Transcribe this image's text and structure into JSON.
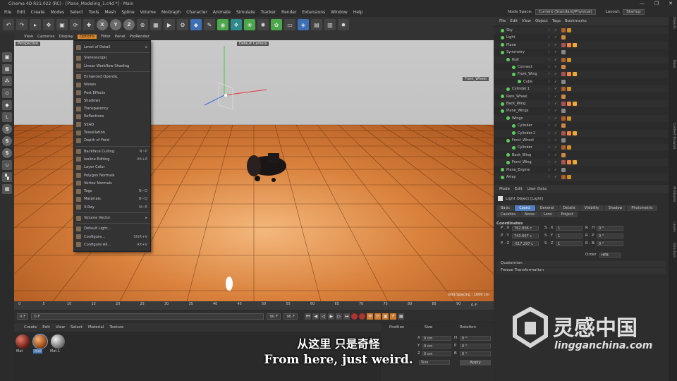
{
  "window": {
    "title": "Cinema 4D R21.022 (RC) - [Plane_Modeling_1.c4d *] - Main",
    "controls": [
      "—",
      "❐",
      "✕"
    ]
  },
  "menubar": [
    "File",
    "Edit",
    "Create",
    "Modes",
    "Select",
    "Tools",
    "Mesh",
    "Spline",
    "Volume",
    "MoGraph",
    "Character",
    "Animate",
    "Simulate",
    "Tracker",
    "Render",
    "Extensions",
    "Window",
    "Help"
  ],
  "nodespace": {
    "label": "Node Space:",
    "value": "Current (Standard/Physical)",
    "layout_label": "Layout:",
    "layout_value": "Startup"
  },
  "toolbar": {
    "axes": [
      "X",
      "Y",
      "Z"
    ]
  },
  "viewport": {
    "menu": [
      "View",
      "Cameras",
      "Display",
      "Options",
      "Filter",
      "Panel",
      "ProRender"
    ],
    "active_menu": "Options",
    "label": "Perspective",
    "camera_label": "Default Camera",
    "object_label": "Front_Wheel",
    "grid_spacing": "Grid Spacing : 1000 cm"
  },
  "options_menu": [
    {
      "label": "Level of Detail",
      "shortcut": "▸",
      "sep_after": true
    },
    {
      "label": "Stereoscopic",
      "shortcut": ""
    },
    {
      "label": "Linear Workflow Shading",
      "shortcut": "",
      "sep_after": true
    },
    {
      "label": "Enhanced OpenGL",
      "shortcut": ""
    },
    {
      "label": "Noises",
      "shortcut": ""
    },
    {
      "label": "Post Effects",
      "shortcut": ""
    },
    {
      "label": "Shadows",
      "shortcut": ""
    },
    {
      "label": "Transparency",
      "shortcut": ""
    },
    {
      "label": "Reflections",
      "shortcut": ""
    },
    {
      "label": "SSAO",
      "shortcut": ""
    },
    {
      "label": "Tessellation",
      "shortcut": ""
    },
    {
      "label": "Depth of Field",
      "shortcut": "",
      "sep_after": true
    },
    {
      "label": "Backface Culling",
      "shortcut": "N~P"
    },
    {
      "label": "Isoline Editing",
      "shortcut": "Alt+A"
    },
    {
      "label": "Layer Color",
      "shortcut": ""
    },
    {
      "label": "Polygon Normals",
      "shortcut": ""
    },
    {
      "label": "Vertex Normals",
      "shortcut": ""
    },
    {
      "label": "Tags",
      "shortcut": "N~O"
    },
    {
      "label": "Materials",
      "shortcut": "N~Q"
    },
    {
      "label": "X-Ray",
      "shortcut": "N~R",
      "sep_after": true
    },
    {
      "label": "Volume Vector",
      "shortcut": "▸",
      "sep_after": true
    },
    {
      "label": "Default Light...",
      "shortcut": ""
    },
    {
      "label": "Configure...",
      "shortcut": "Shift+V"
    },
    {
      "label": "Configure All...",
      "shortcut": "Alt+V"
    }
  ],
  "timeline": {
    "ticks": [
      "0",
      "5",
      "10",
      "15",
      "20",
      "25",
      "30",
      "35",
      "40",
      "45",
      "50",
      "55",
      "60",
      "65",
      "70",
      "75",
      "80",
      "85",
      "90"
    ],
    "end": "0 F"
  },
  "transport": {
    "start": "0 F",
    "current": "0 F",
    "end": "90 F",
    "end2": "90 F"
  },
  "material_manager": {
    "menu": [
      "Create",
      "Edit",
      "View",
      "Select",
      "Material",
      "Texture"
    ],
    "materials": [
      "Mat",
      "Mat",
      "Mat.1"
    ]
  },
  "coord_manager": {
    "headers": [
      "Position",
      "Size",
      "Rotation"
    ],
    "rows": [
      {
        "axis": "X",
        "pos": "0 cm",
        "size": "0 cm",
        "rlabel": "H",
        "rot": "0 °"
      },
      {
        "axis": "Y",
        "pos": "0 cm",
        "size": "0 cm",
        "rlabel": "P",
        "rot": "0 °"
      },
      {
        "axis": "Z",
        "pos": "0 cm",
        "size": "0 cm",
        "rlabel": "B",
        "rot": "0 °"
      }
    ],
    "mode": "Size",
    "apply": "Apply"
  },
  "object_manager": {
    "menu": [
      "File",
      "Edit",
      "View",
      "Object",
      "Tags",
      "Bookmarks"
    ],
    "objects": [
      {
        "name": "Sky",
        "indent": 0
      },
      {
        "name": "Light",
        "indent": 0
      },
      {
        "name": "Plane",
        "indent": 0
      },
      {
        "name": "Symmetry",
        "indent": 0
      },
      {
        "name": "Null",
        "indent": 1
      },
      {
        "name": "Connect",
        "indent": 2
      },
      {
        "name": "Front_Wing",
        "indent": 2
      },
      {
        "name": "Cube",
        "indent": 3
      },
      {
        "name": "Cylinder.1",
        "indent": 1
      },
      {
        "name": "Rare_Wheel",
        "indent": 0
      },
      {
        "name": "Back_Wing",
        "indent": 0
      },
      {
        "name": "Plane_Wings",
        "indent": 0
      },
      {
        "name": "Wings",
        "indent": 1
      },
      {
        "name": "Cylinder",
        "indent": 2
      },
      {
        "name": "Cylinder.1",
        "indent": 2
      },
      {
        "name": "Front_Wheel",
        "indent": 1
      },
      {
        "name": "Cylinder",
        "indent": 2
      },
      {
        "name": "Back_Wing",
        "indent": 1
      },
      {
        "name": "Front_Wing",
        "indent": 1
      },
      {
        "name": "Plane_Engine",
        "indent": 0
      },
      {
        "name": "Array",
        "indent": 0
      }
    ]
  },
  "attributes": {
    "menu": [
      "Mode",
      "Edit",
      "User Data"
    ],
    "object": "Light Object [Light]",
    "tabs": [
      "Basic",
      "Coord.",
      "General",
      "Details",
      "Visibility",
      "Shadow",
      "Photometric",
      "Caustics",
      "Noise",
      "Lens",
      "Project"
    ],
    "active_tab": "Coord.",
    "section": "Coordinates",
    "rows": [
      {
        "a": "P . X",
        "av": "762.806 c",
        "b": "S . X",
        "bv": "1",
        "c": "R . H",
        "cv": "0 °"
      },
      {
        "a": "P . Y",
        "av": "743.667 c",
        "b": "S . Y",
        "bv": "1",
        "c": "R . P",
        "cv": "0 °"
      },
      {
        "a": "P . Z",
        "av": "-517.297 c",
        "b": "S . Z",
        "bv": "1",
        "c": "R . B",
        "cv": "0 °"
      }
    ],
    "order_label": "Order",
    "order_value": "HPB",
    "collapsed": [
      "Quaternion",
      "Freeze Transformation"
    ]
  },
  "right_strip": [
    "Objects",
    "Takes",
    "Content Browser",
    "Attributes",
    "Layers",
    "Structure"
  ],
  "subtitle": {
    "cn": "从这里 只是奇怪",
    "en": "From here, just weird."
  },
  "watermark": {
    "cn": "灵感中国",
    "en": "lingganchina.com"
  }
}
